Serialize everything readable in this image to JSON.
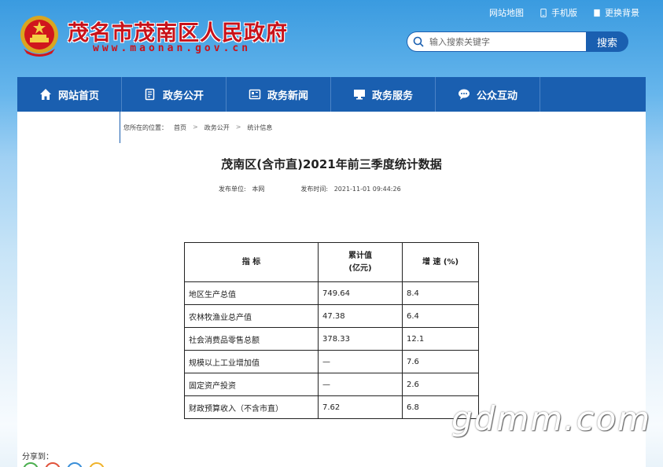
{
  "header": {
    "title": "茂名市茂南区人民政府",
    "url": "www.maonan.gov.cn",
    "toplinks": [
      "网站地图",
      "手机版",
      "更换背景"
    ],
    "search_placeholder": "输入搜索关键字",
    "search_button": "搜索"
  },
  "nav": {
    "items": [
      {
        "label": "网站首页",
        "icon": "home-icon"
      },
      {
        "label": "政务公开",
        "icon": "document-icon"
      },
      {
        "label": "政务新闻",
        "icon": "news-icon"
      },
      {
        "label": "政务服务",
        "icon": "monitor-icon"
      },
      {
        "label": "公众互动",
        "icon": "chat-icon"
      }
    ]
  },
  "breadcrumb": {
    "prefix": "您所在的位置：",
    "items": [
      "首页",
      "政务公开",
      "统计信息"
    ],
    "separator": ">"
  },
  "article": {
    "title": "茂南区(含市直)2021年前三季度统计数据",
    "publisher_label": "发布单位:",
    "publisher": "本网",
    "time_label": "发布时间:",
    "time": "2021-11-01 09:44:26"
  },
  "table": {
    "headers": [
      "指  标",
      "累计值",
      "(亿元)",
      "增 速 (%)"
    ],
    "rows": [
      [
        "地区生产总值",
        "749.64",
        "8.4"
      ],
      [
        "农林牧渔业总产值",
        "47.38",
        "6.4"
      ],
      [
        "社会消费品零售总额",
        "378.33",
        "12.1"
      ],
      [
        "规模以上工业增加值",
        "—",
        "7.6"
      ],
      [
        "固定资产投资",
        "—",
        "2.6"
      ],
      [
        "财政预算收入（不含市直）",
        "7.62",
        "6.8"
      ]
    ]
  },
  "share": {
    "label": "分享到："
  },
  "watermark": "gdmm.com",
  "colors": {
    "brand_red": "#c8121a",
    "nav_blue": "#1a5fb0"
  }
}
